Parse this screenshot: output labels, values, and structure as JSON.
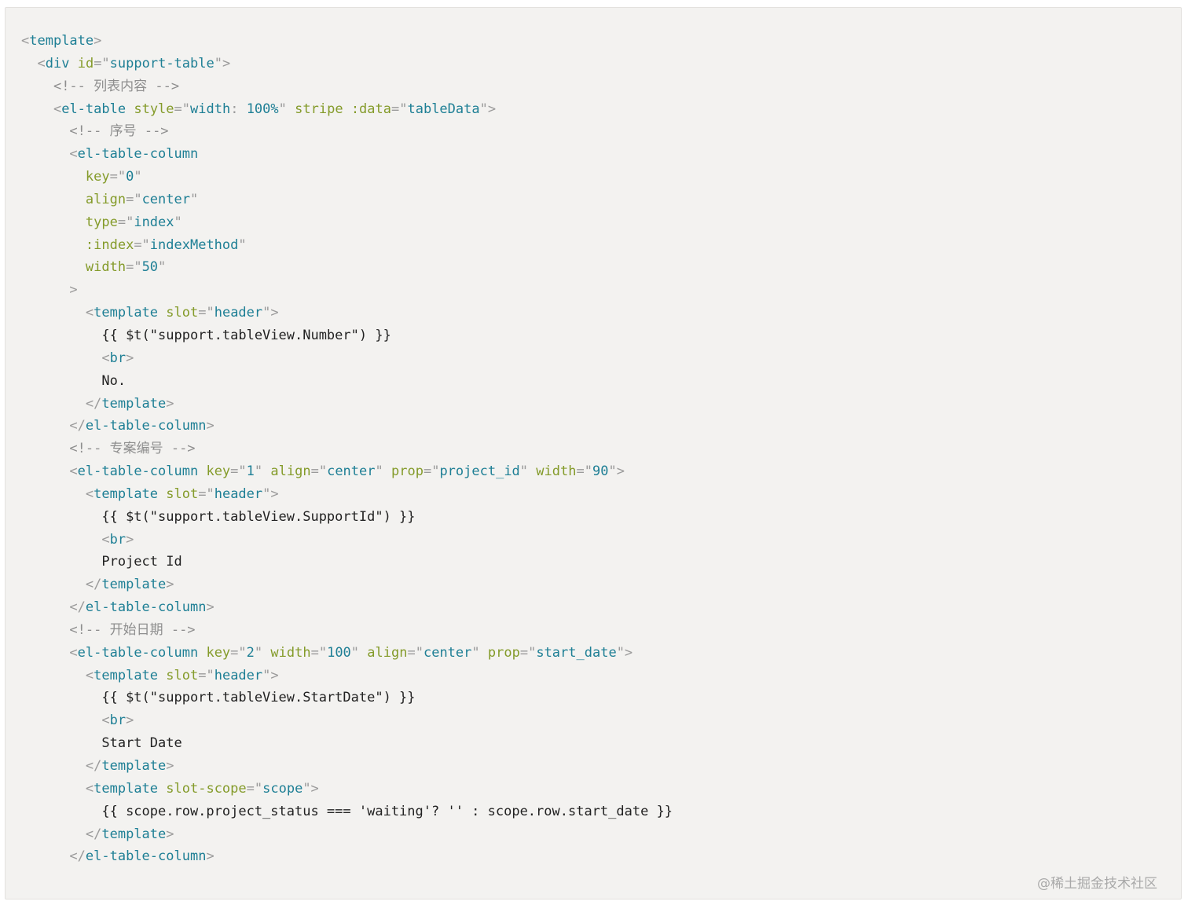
{
  "code": {
    "lines": [
      {
        "indent": "",
        "tokens": [
          {
            "k": "punc",
            "t": "<"
          },
          {
            "k": "tag",
            "t": "template"
          },
          {
            "k": "punc",
            "t": ">"
          }
        ]
      },
      {
        "indent": "  ",
        "tokens": [
          {
            "k": "punc",
            "t": "<"
          },
          {
            "k": "tag",
            "t": "div"
          },
          {
            "k": "text",
            "t": " "
          },
          {
            "k": "attr",
            "t": "id"
          },
          {
            "k": "punc",
            "t": "=\""
          },
          {
            "k": "str",
            "t": "support-table"
          },
          {
            "k": "punc",
            "t": "\">"
          }
        ]
      },
      {
        "indent": "    ",
        "tokens": [
          {
            "k": "comment",
            "t": "<!-- 列表内容 -->"
          }
        ]
      },
      {
        "indent": "    ",
        "tokens": [
          {
            "k": "punc",
            "t": "<"
          },
          {
            "k": "tag",
            "t": "el-table"
          },
          {
            "k": "text",
            "t": " "
          },
          {
            "k": "attr",
            "t": "style"
          },
          {
            "k": "punc",
            "t": "=\""
          },
          {
            "k": "str",
            "t": "width"
          },
          {
            "k": "punc",
            "t": ": "
          },
          {
            "k": "str",
            "t": "100%"
          },
          {
            "k": "punc",
            "t": "\""
          },
          {
            "k": "text",
            "t": " "
          },
          {
            "k": "attr",
            "t": "stripe"
          },
          {
            "k": "text",
            "t": " "
          },
          {
            "k": "attr",
            "t": ":data"
          },
          {
            "k": "punc",
            "t": "=\""
          },
          {
            "k": "str",
            "t": "tableData"
          },
          {
            "k": "punc",
            "t": "\">"
          }
        ]
      },
      {
        "indent": "      ",
        "tokens": [
          {
            "k": "comment",
            "t": "<!-- 序号 -->"
          }
        ]
      },
      {
        "indent": "      ",
        "tokens": [
          {
            "k": "punc",
            "t": "<"
          },
          {
            "k": "tag",
            "t": "el-table-column"
          }
        ]
      },
      {
        "indent": "        ",
        "tokens": [
          {
            "k": "attr",
            "t": "key"
          },
          {
            "k": "punc",
            "t": "=\""
          },
          {
            "k": "str",
            "t": "0"
          },
          {
            "k": "punc",
            "t": "\""
          }
        ]
      },
      {
        "indent": "        ",
        "tokens": [
          {
            "k": "attr",
            "t": "align"
          },
          {
            "k": "punc",
            "t": "=\""
          },
          {
            "k": "str",
            "t": "center"
          },
          {
            "k": "punc",
            "t": "\""
          }
        ]
      },
      {
        "indent": "        ",
        "tokens": [
          {
            "k": "attr",
            "t": "type"
          },
          {
            "k": "punc",
            "t": "=\""
          },
          {
            "k": "str",
            "t": "index"
          },
          {
            "k": "punc",
            "t": "\""
          }
        ]
      },
      {
        "indent": "        ",
        "tokens": [
          {
            "k": "attr",
            "t": ":index"
          },
          {
            "k": "punc",
            "t": "=\""
          },
          {
            "k": "str",
            "t": "indexMethod"
          },
          {
            "k": "punc",
            "t": "\""
          }
        ]
      },
      {
        "indent": "        ",
        "tokens": [
          {
            "k": "attr",
            "t": "width"
          },
          {
            "k": "punc",
            "t": "=\""
          },
          {
            "k": "str",
            "t": "50"
          },
          {
            "k": "punc",
            "t": "\""
          }
        ]
      },
      {
        "indent": "      ",
        "tokens": [
          {
            "k": "punc",
            "t": ">"
          }
        ]
      },
      {
        "indent": "        ",
        "tokens": [
          {
            "k": "punc",
            "t": "<"
          },
          {
            "k": "tag",
            "t": "template"
          },
          {
            "k": "text",
            "t": " "
          },
          {
            "k": "attr",
            "t": "slot"
          },
          {
            "k": "punc",
            "t": "=\""
          },
          {
            "k": "str",
            "t": "header"
          },
          {
            "k": "punc",
            "t": "\">"
          }
        ]
      },
      {
        "indent": "          ",
        "tokens": [
          {
            "k": "text",
            "t": "{{ $t(\"support.tableView.Number\") }}"
          }
        ]
      },
      {
        "indent": "          ",
        "tokens": [
          {
            "k": "punc",
            "t": "<"
          },
          {
            "k": "tag",
            "t": "br"
          },
          {
            "k": "punc",
            "t": ">"
          }
        ]
      },
      {
        "indent": "          ",
        "tokens": [
          {
            "k": "text",
            "t": "No."
          }
        ]
      },
      {
        "indent": "        ",
        "tokens": [
          {
            "k": "punc",
            "t": "</"
          },
          {
            "k": "tag",
            "t": "template"
          },
          {
            "k": "punc",
            "t": ">"
          }
        ]
      },
      {
        "indent": "      ",
        "tokens": [
          {
            "k": "punc",
            "t": "</"
          },
          {
            "k": "tag",
            "t": "el-table-column"
          },
          {
            "k": "punc",
            "t": ">"
          }
        ]
      },
      {
        "indent": "      ",
        "tokens": [
          {
            "k": "comment",
            "t": "<!-- 专案编号 -->"
          }
        ]
      },
      {
        "indent": "      ",
        "tokens": [
          {
            "k": "punc",
            "t": "<"
          },
          {
            "k": "tag",
            "t": "el-table-column"
          },
          {
            "k": "text",
            "t": " "
          },
          {
            "k": "attr",
            "t": "key"
          },
          {
            "k": "punc",
            "t": "=\""
          },
          {
            "k": "str",
            "t": "1"
          },
          {
            "k": "punc",
            "t": "\""
          },
          {
            "k": "text",
            "t": " "
          },
          {
            "k": "attr",
            "t": "align"
          },
          {
            "k": "punc",
            "t": "=\""
          },
          {
            "k": "str",
            "t": "center"
          },
          {
            "k": "punc",
            "t": "\""
          },
          {
            "k": "text",
            "t": " "
          },
          {
            "k": "attr",
            "t": "prop"
          },
          {
            "k": "punc",
            "t": "=\""
          },
          {
            "k": "str",
            "t": "project_id"
          },
          {
            "k": "punc",
            "t": "\""
          },
          {
            "k": "text",
            "t": " "
          },
          {
            "k": "attr",
            "t": "width"
          },
          {
            "k": "punc",
            "t": "=\""
          },
          {
            "k": "str",
            "t": "90"
          },
          {
            "k": "punc",
            "t": "\">"
          }
        ]
      },
      {
        "indent": "        ",
        "tokens": [
          {
            "k": "punc",
            "t": "<"
          },
          {
            "k": "tag",
            "t": "template"
          },
          {
            "k": "text",
            "t": " "
          },
          {
            "k": "attr",
            "t": "slot"
          },
          {
            "k": "punc",
            "t": "=\""
          },
          {
            "k": "str",
            "t": "header"
          },
          {
            "k": "punc",
            "t": "\">"
          }
        ]
      },
      {
        "indent": "          ",
        "tokens": [
          {
            "k": "text",
            "t": "{{ $t(\"support.tableView.SupportId\") }}"
          }
        ]
      },
      {
        "indent": "          ",
        "tokens": [
          {
            "k": "punc",
            "t": "<"
          },
          {
            "k": "tag",
            "t": "br"
          },
          {
            "k": "punc",
            "t": ">"
          }
        ]
      },
      {
        "indent": "          ",
        "tokens": [
          {
            "k": "text",
            "t": "Project Id"
          }
        ]
      },
      {
        "indent": "        ",
        "tokens": [
          {
            "k": "punc",
            "t": "</"
          },
          {
            "k": "tag",
            "t": "template"
          },
          {
            "k": "punc",
            "t": ">"
          }
        ]
      },
      {
        "indent": "      ",
        "tokens": [
          {
            "k": "punc",
            "t": "</"
          },
          {
            "k": "tag",
            "t": "el-table-column"
          },
          {
            "k": "punc",
            "t": ">"
          }
        ]
      },
      {
        "indent": "      ",
        "tokens": [
          {
            "k": "comment",
            "t": "<!-- 开始日期 -->"
          }
        ]
      },
      {
        "indent": "      ",
        "tokens": [
          {
            "k": "punc",
            "t": "<"
          },
          {
            "k": "tag",
            "t": "el-table-column"
          },
          {
            "k": "text",
            "t": " "
          },
          {
            "k": "attr",
            "t": "key"
          },
          {
            "k": "punc",
            "t": "=\""
          },
          {
            "k": "str",
            "t": "2"
          },
          {
            "k": "punc",
            "t": "\""
          },
          {
            "k": "text",
            "t": " "
          },
          {
            "k": "attr",
            "t": "width"
          },
          {
            "k": "punc",
            "t": "=\""
          },
          {
            "k": "str",
            "t": "100"
          },
          {
            "k": "punc",
            "t": "\""
          },
          {
            "k": "text",
            "t": " "
          },
          {
            "k": "attr",
            "t": "align"
          },
          {
            "k": "punc",
            "t": "=\""
          },
          {
            "k": "str",
            "t": "center"
          },
          {
            "k": "punc",
            "t": "\""
          },
          {
            "k": "text",
            "t": " "
          },
          {
            "k": "attr",
            "t": "prop"
          },
          {
            "k": "punc",
            "t": "=\""
          },
          {
            "k": "str",
            "t": "start_date"
          },
          {
            "k": "punc",
            "t": "\">"
          }
        ]
      },
      {
        "indent": "        ",
        "tokens": [
          {
            "k": "punc",
            "t": "<"
          },
          {
            "k": "tag",
            "t": "template"
          },
          {
            "k": "text",
            "t": " "
          },
          {
            "k": "attr",
            "t": "slot"
          },
          {
            "k": "punc",
            "t": "=\""
          },
          {
            "k": "str",
            "t": "header"
          },
          {
            "k": "punc",
            "t": "\">"
          }
        ]
      },
      {
        "indent": "          ",
        "tokens": [
          {
            "k": "text",
            "t": "{{ $t(\"support.tableView.StartDate\") }}"
          }
        ]
      },
      {
        "indent": "          ",
        "tokens": [
          {
            "k": "punc",
            "t": "<"
          },
          {
            "k": "tag",
            "t": "br"
          },
          {
            "k": "punc",
            "t": ">"
          }
        ]
      },
      {
        "indent": "          ",
        "tokens": [
          {
            "k": "text",
            "t": "Start Date"
          }
        ]
      },
      {
        "indent": "        ",
        "tokens": [
          {
            "k": "punc",
            "t": "</"
          },
          {
            "k": "tag",
            "t": "template"
          },
          {
            "k": "punc",
            "t": ">"
          }
        ]
      },
      {
        "indent": "        ",
        "tokens": [
          {
            "k": "punc",
            "t": "<"
          },
          {
            "k": "tag",
            "t": "template"
          },
          {
            "k": "text",
            "t": " "
          },
          {
            "k": "attr",
            "t": "slot-scope"
          },
          {
            "k": "punc",
            "t": "=\""
          },
          {
            "k": "str",
            "t": "scope"
          },
          {
            "k": "punc",
            "t": "\">"
          }
        ]
      },
      {
        "indent": "          ",
        "tokens": [
          {
            "k": "text",
            "t": "{{ scope.row.project_status === 'waiting'? '' : scope.row.start_date }}"
          }
        ]
      },
      {
        "indent": "        ",
        "tokens": [
          {
            "k": "punc",
            "t": "</"
          },
          {
            "k": "tag",
            "t": "template"
          },
          {
            "k": "punc",
            "t": ">"
          }
        ]
      },
      {
        "indent": "      ",
        "tokens": [
          {
            "k": "punc",
            "t": "</"
          },
          {
            "k": "tag",
            "t": "el-table-column"
          },
          {
            "k": "punc",
            "t": ">"
          }
        ]
      }
    ]
  },
  "watermark": "@稀土掘金技术社区",
  "colors": {
    "panel_bg": "#f3f2f0",
    "tag": "#1e7f95",
    "attr": "#849b2a",
    "comment": "#8e8e8e",
    "text": "#222222"
  }
}
